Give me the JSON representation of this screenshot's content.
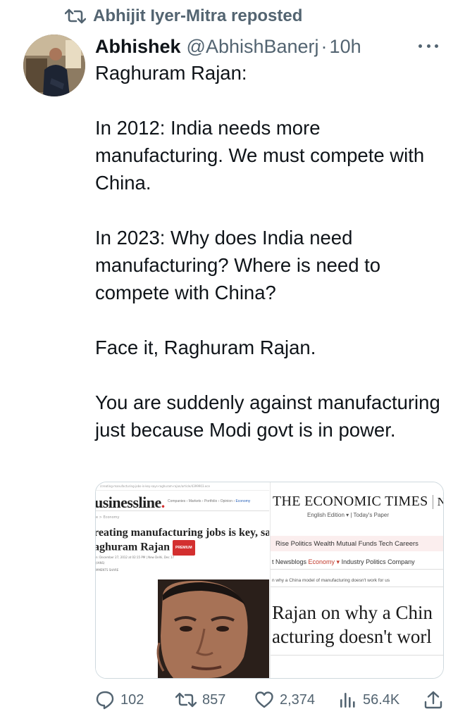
{
  "repost": {
    "label": "Abhijit Iyer-Mitra reposted"
  },
  "author": {
    "name": "Abhishek",
    "handle": "@AbhishBanerj",
    "separator": "·",
    "time": "10h"
  },
  "tweet": {
    "paragraphs": [
      "Raghuram Rajan:",
      "In 2012:  India needs more manufacturing. We must compete with China.",
      "In 2023: Why does India need manufacturing? Where is need to compete with China?",
      "Face it, Raghuram Rajan.",
      "You are suddenly against manufacturing just because Modi govt is in power."
    ]
  },
  "media": {
    "left": {
      "url_bar": "/creating-manufacturing-jobs-is-key-says-raghuram-rajan/article/4399903.ece",
      "logo_main": "usinessline",
      "logo_dot": ".",
      "nav": "Companies › Markets › Portfolio › Opinion ›",
      "nav_active": "Economy",
      "breadcrumb": "e > Economy",
      "headline_1": "reating manufacturing jobs is key, sa",
      "headline_2": "aghuram Rajan",
      "badge": "PREMIUM",
      "meta_1": "n: December 27, 2012 at 02:15 PM | New Delhi, Dec 17",
      "meta_2": "(IANS)",
      "meta_3": "MMENTS     SHARE"
    },
    "right": {
      "logo": "THE ECONOMIC TIMES",
      "logo_suffix": "News",
      "edition": "English Edition ▾  |  Today's Paper",
      "nav": "Rise   Politics   Wealth   Mutual Funds   Tech   Careers",
      "subnav_prefix": "t   Newsblogs   ",
      "subnav_active": "Economy ▾",
      "subnav_suffix": "   Industry   Politics   Company",
      "breadcrumb": "n why a China model of manufacturing doesn't work for us",
      "title_1": "Rajan on why a Chin",
      "title_2": "acturing doesn't worl"
    }
  },
  "actions": {
    "replies": "102",
    "reposts": "857",
    "likes": "2,374",
    "views": "56.4K"
  },
  "colors": {
    "muted": "#536471",
    "text": "#0f1419",
    "border": "#cfd9de"
  }
}
